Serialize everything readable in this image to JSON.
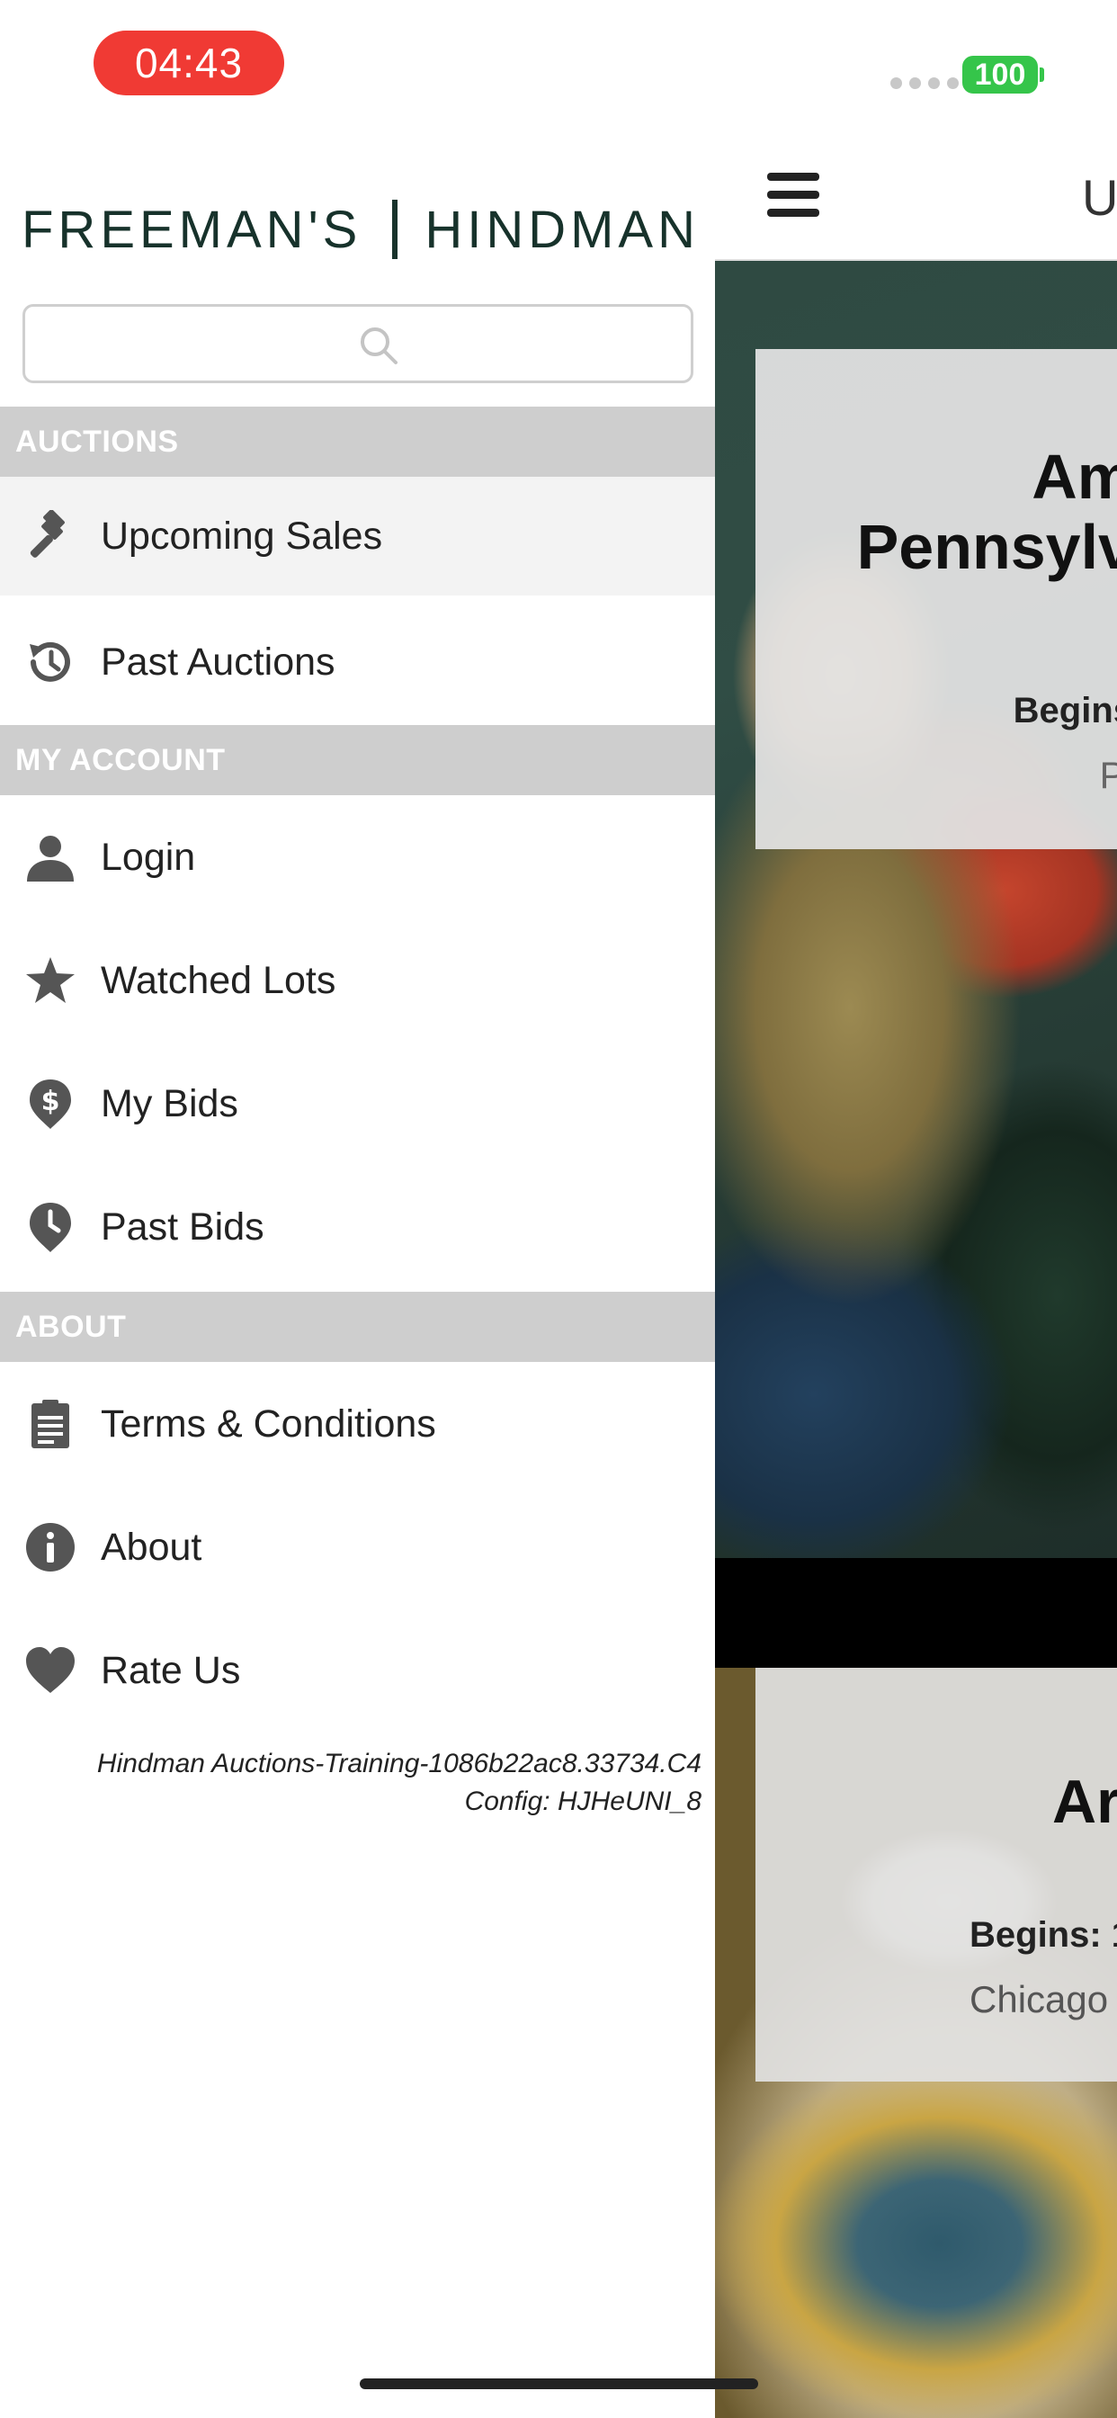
{
  "status_bar": {
    "time": "04:43",
    "battery": "100"
  },
  "drawer": {
    "logo_left": "FREEMAN'S",
    "logo_right": "HINDMAN",
    "search": {
      "placeholder": "",
      "value": ""
    },
    "sections": [
      {
        "header": "AUCTIONS",
        "items": [
          {
            "label": "Upcoming Sales",
            "icon": "gavel-icon",
            "active": true
          },
          {
            "label": "Past Auctions",
            "icon": "history-icon"
          }
        ]
      },
      {
        "header": "MY ACCOUNT",
        "items": [
          {
            "label": "Login",
            "icon": "user-icon"
          },
          {
            "label": "Watched Lots",
            "icon": "star-icon"
          },
          {
            "label": "My Bids",
            "icon": "dollar-pin-icon"
          },
          {
            "label": "Past Bids",
            "icon": "clock-pin-icon"
          }
        ]
      },
      {
        "header": "ABOUT",
        "items": [
          {
            "label": "Terms & Conditions",
            "icon": "document-icon"
          },
          {
            "label": "About",
            "icon": "info-icon"
          },
          {
            "label": "Rate Us",
            "icon": "heart-icon"
          }
        ]
      }
    ],
    "build_info_line1": "Hindman Auctions-Training-1086b22ac8.33734.C4",
    "build_info_line2": "Config: HJHeUNI_8"
  },
  "main": {
    "header_title": "U",
    "card1": {
      "title_line1": "Am",
      "title_line2": "Pennsylv",
      "begins": "Begins",
      "location": "Pl"
    },
    "card2": {
      "title": "Ar",
      "begins": "Begins: 1",
      "location": "Chicago"
    }
  }
}
